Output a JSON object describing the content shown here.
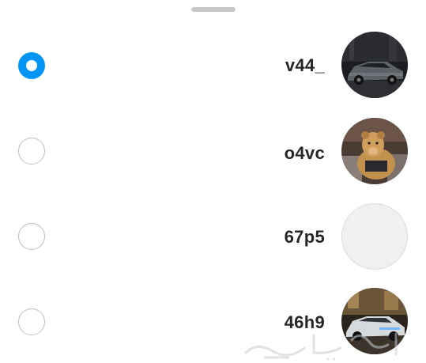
{
  "accounts": [
    {
      "username": "v44_",
      "selected": true,
      "avatar": "car-photo-night"
    },
    {
      "username": "o4vc",
      "selected": false,
      "avatar": "lion-cub-photo"
    },
    {
      "username": "67p5",
      "selected": false,
      "avatar": "empty-placeholder"
    },
    {
      "username": "46h9",
      "selected": false,
      "avatar": "car-photo-lit"
    }
  ],
  "colors": {
    "accent": "#0095f6",
    "text": "#262626",
    "radio_border": "#bdbdbd",
    "handle": "#c8c8c8"
  }
}
